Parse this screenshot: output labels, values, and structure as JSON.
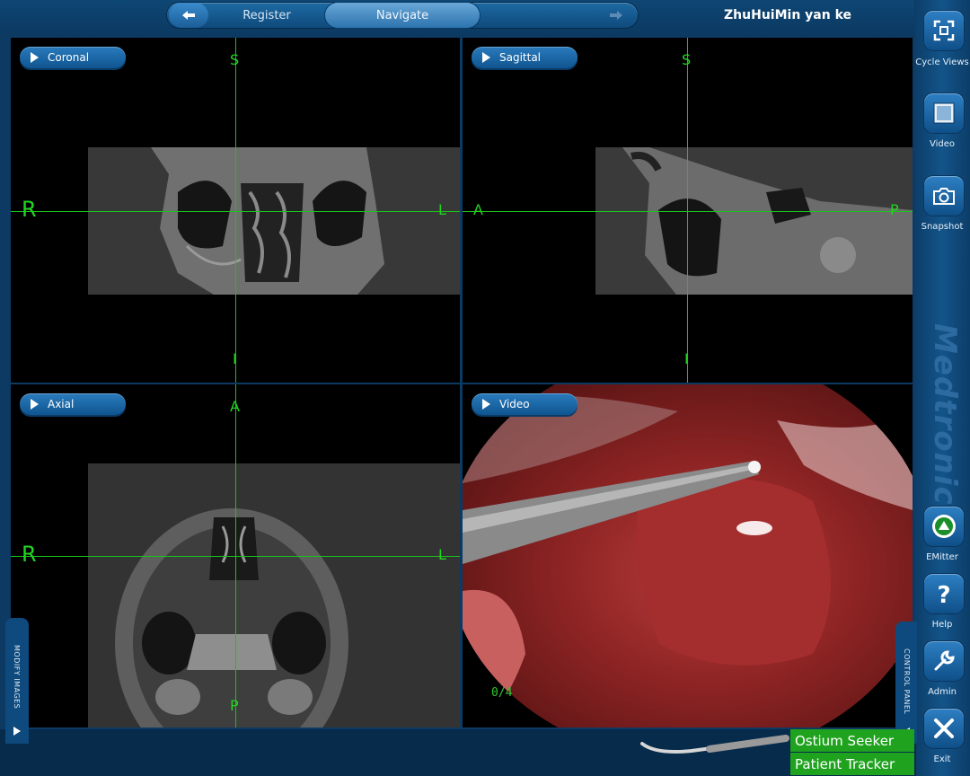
{
  "header": {
    "back_icon": "left-arrow-icon",
    "forward_icon": "right-arrow-icon",
    "tabs": [
      {
        "label": "Register"
      },
      {
        "label": "Navigate"
      }
    ],
    "user": "ZhuHuiMin yan ke"
  },
  "views": {
    "coronal": {
      "label": "Coronal",
      "top": "S",
      "bottom": "I",
      "left": "R",
      "right": "L"
    },
    "sagittal": {
      "label": "Sagittal",
      "top": "S",
      "bottom": "I",
      "left": "A",
      "right": "P"
    },
    "axial": {
      "label": "Axial",
      "top": "A",
      "bottom": "P",
      "left": "R",
      "right": "L"
    },
    "video": {
      "label": "Video",
      "counter": "0/4"
    }
  },
  "sidebar": {
    "brand": "Medtronic",
    "buttons": [
      {
        "label": "Cycle Views",
        "icon": "cycle-views-icon"
      },
      {
        "label": "Video",
        "icon": "video-icon"
      },
      {
        "label": "Snapshot",
        "icon": "camera-icon"
      },
      {
        "label": "EMitter",
        "icon": "emitter-icon"
      },
      {
        "label": "Help",
        "icon": "question-icon"
      },
      {
        "label": "Admin",
        "icon": "wrench-icon"
      },
      {
        "label": "Exit",
        "icon": "close-icon"
      }
    ]
  },
  "bottom": {
    "left_tab": "MODIFY IMAGES",
    "right_tab": "CONTROL PANEL",
    "tools": [
      {
        "name": "Ostium Seeker"
      },
      {
        "name": "Patient Tracker"
      }
    ]
  },
  "colors": {
    "overlay_green": "#19c419",
    "status_green": "#1fa31f",
    "frame_blue": "#0d3a63"
  }
}
